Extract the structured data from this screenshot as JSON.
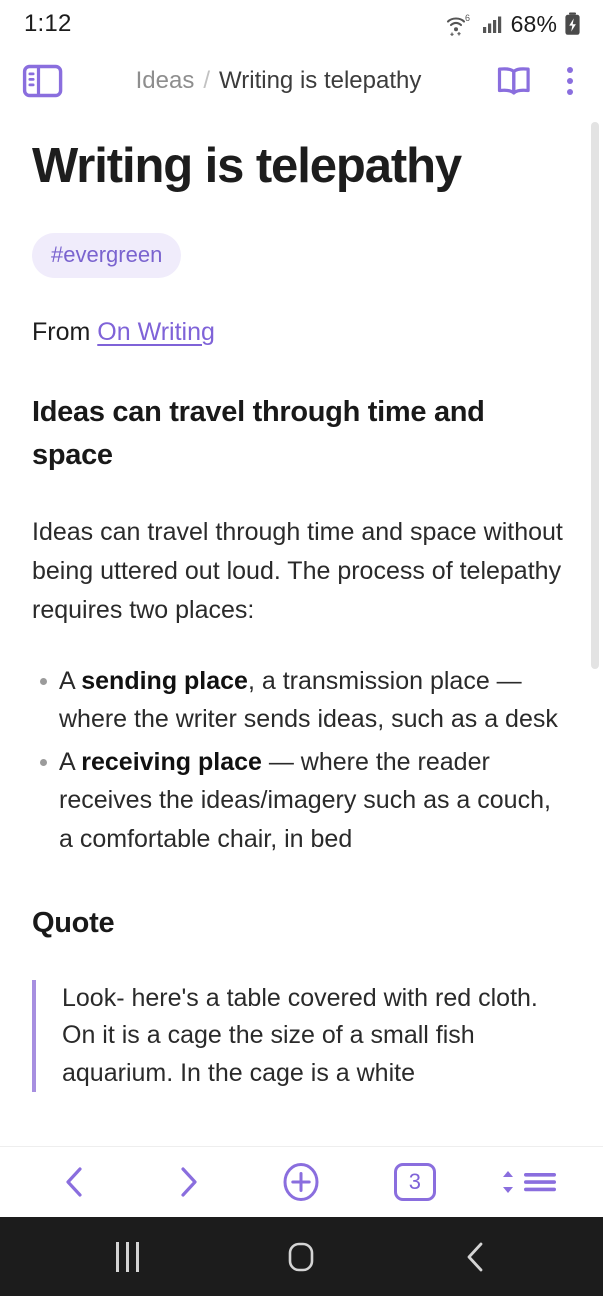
{
  "status_bar": {
    "time": "1:12",
    "battery_percent": "68%",
    "wifi_icon": "wifi-6-icon",
    "signal_icon": "cellular-signal-icon",
    "battery_icon": "battery-charging-icon"
  },
  "app_bar": {
    "sidebar_toggle_icon": "sidebar-panel-icon",
    "breadcrumb": {
      "parent": "Ideas",
      "separator": "/",
      "current": "Writing is telepathy"
    },
    "reading_mode_icon": "open-book-icon",
    "overflow_menu_icon": "more-vertical-icon"
  },
  "note": {
    "title": "Writing is telepathy",
    "tags": [
      "#evergreen"
    ],
    "from_label": "From",
    "source_link": "On Writing",
    "heading_1": "Ideas can travel through time and space",
    "paragraph_1": "Ideas can travel through time and space without being uttered out loud. The process of telepathy requires two places:",
    "bullets": [
      {
        "prefix": "A ",
        "bold": "sending place",
        "suffix": ", a transmission place — where the writer sends ideas, such as a desk"
      },
      {
        "prefix": "A ",
        "bold": "receiving place",
        "suffix": " — where the reader receives the ideas/imagery such as a couch, a comfortable chair, in bed"
      }
    ],
    "heading_2": "Quote",
    "blockquote": "Look- here's a table covered with red cloth. On it is a cage the size of a small fish aquarium. In the cage is a white"
  },
  "toolbar": {
    "back_icon": "chevron-left-icon",
    "forward_icon": "chevron-right-icon",
    "new_note_icon": "plus-circle-icon",
    "tab_count": "3",
    "outline_icon": "sort-list-icon"
  },
  "android_nav": {
    "recents_icon": "recents-icon",
    "home_icon": "home-icon",
    "back_icon": "nav-back-icon"
  },
  "colors": {
    "accent_purple": "#8a6ede",
    "link_purple": "#7f63d8",
    "tag_background": "#f0ecfb",
    "quote_border": "#a78fe0",
    "nav_bar_background": "#1c1c1c",
    "scrollbar_thumb": "#e3e3e3"
  }
}
